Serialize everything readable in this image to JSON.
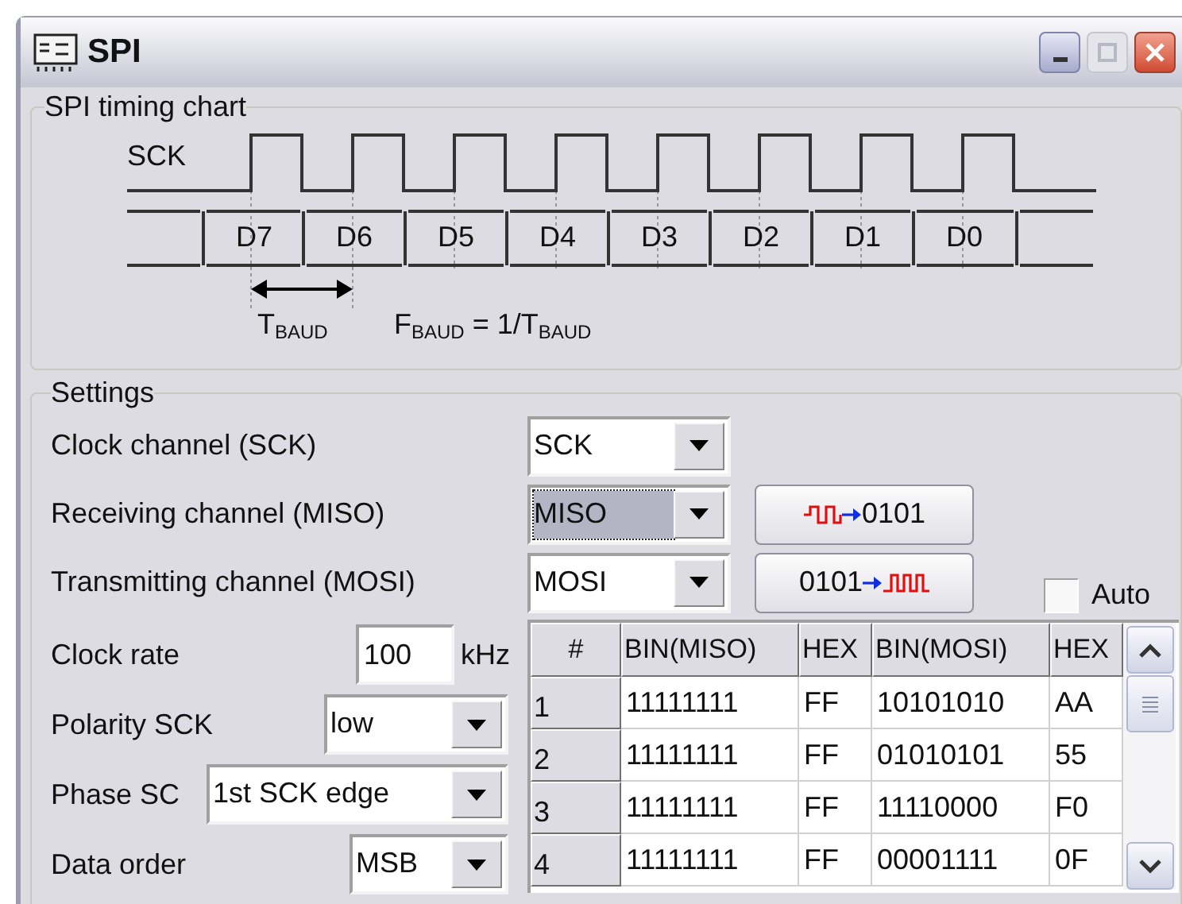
{
  "window": {
    "title": "SPI"
  },
  "timing_chart": {
    "title": "SPI timing chart",
    "signal_label": "SCK",
    "bits": [
      "D7",
      "D6",
      "D5",
      "D4",
      "D3",
      "D2",
      "D1",
      "D0"
    ],
    "period_label": "T$_{BAUD}$",
    "formula": "F$_{BAUD}$ = 1/T$_{BAUD}$"
  },
  "settings": {
    "title": "Settings",
    "clock_channel": {
      "label": "Clock channel (SCK)",
      "value": "SCK",
      "focused": false
    },
    "receiving_channel": {
      "label": "Receiving channel (MISO)",
      "value": "MISO",
      "focused": true,
      "button": "0101"
    },
    "transmitting_channel": {
      "label": "Transmitting channel (MOSI)",
      "value": "MOSI",
      "focused": false,
      "button": "0101"
    },
    "auto": {
      "label": "Auto",
      "checked": false
    },
    "clock_rate": {
      "label": "Clock rate",
      "value": "100",
      "unit": "kHz"
    },
    "polarity": {
      "label": "Polarity SCK",
      "value": "low",
      "focused": false
    },
    "phase": {
      "label": "Phase SC",
      "value": "1st SCK edge",
      "focused": false
    },
    "data_order": {
      "label": "Data order",
      "value": "MSB",
      "focused": false
    }
  },
  "table": {
    "columns": [
      "#",
      "BIN(MISO)",
      "HEX",
      "BIN(MOSI)",
      "HEX"
    ],
    "rows": [
      [
        "1",
        "11111111",
        "FF",
        "10101010",
        "AA"
      ],
      [
        "2",
        "11111111",
        "FF",
        "01010101",
        "55"
      ],
      [
        "3",
        "11111111",
        "FF",
        "11110000",
        "F0"
      ],
      [
        "4",
        "11111111",
        "FF",
        "00001111",
        "0F"
      ]
    ]
  }
}
